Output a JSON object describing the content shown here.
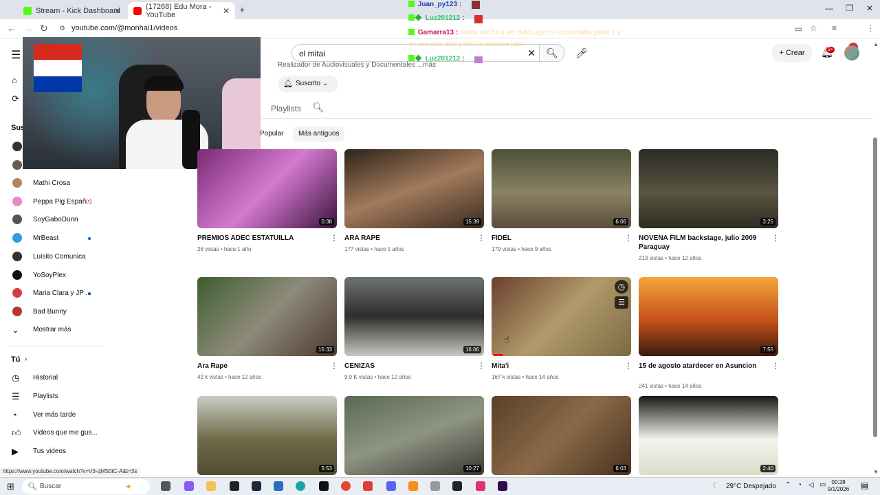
{
  "browser": {
    "tabs": [
      {
        "label": "Stream - Kick Dashboard",
        "favicon_color": "#53fc18",
        "active": false
      },
      {
        "label": "(17268) Edu Mora - YouTube",
        "favicon_color": "#ff0000",
        "active": true
      }
    ],
    "url": "youtube.com/@monhai1/videos"
  },
  "header": {
    "search_value": "el mitai",
    "create_label": "Crear",
    "notifications_badge": "9+"
  },
  "channel": {
    "description": "Realizador de Audiovisuales y Documentales ...más",
    "subscribe_label": "Suscrito",
    "tab_playlists": "Playlists",
    "chips": [
      "Popular",
      "Más antiguos"
    ]
  },
  "sidebar": {
    "subs_heading": "Sus",
    "subscriptions": [
      {
        "label": "Mathi Crosa",
        "color": "#b9835a",
        "dot": false
      },
      {
        "label": "Peppa Pig Españ...",
        "color": "#e98ac7",
        "live": true
      },
      {
        "label": "SoyGaboDunn",
        "color": "#555555",
        "dot": false
      },
      {
        "label": "MrBeast",
        "color": "#2d9fd8",
        "dot": true
      },
      {
        "label": "Luisito Comunica",
        "color": "#333333",
        "dot": false
      },
      {
        "label": "YoSoyPlex",
        "color": "#111111",
        "dot": false
      },
      {
        "label": "Maria Clara y JP ...",
        "color": "#d23d4a",
        "dot": true
      },
      {
        "label": "Bad Bunny",
        "color": "#b23a2b",
        "dot": false
      }
    ],
    "show_more": "Mostrar más",
    "you_heading": "Tú",
    "you_items": [
      "Historial",
      "Playlists",
      "Ver más tarde",
      "Videos que me gus...",
      "Tus videos"
    ]
  },
  "chat": [
    {
      "user": "Juan_py123",
      "user_color": "#1a3fb5",
      "message": "",
      "badge": "k"
    },
    {
      "user": "Luz201212",
      "user_color": "#39c46f",
      "message": "",
      "badge": "kg"
    },
    {
      "user": "Gamarra13",
      "user_color": "#c2185b",
      "message": "Samo me fui a ver mita'i ayer si encontraba parte 2 y",
      "badge": "k"
    },
    {
      "user": "",
      "user_color": "#c2185b",
      "message": "en ese que dice película aparece jaka",
      "badge": ""
    },
    {
      "user": "Luz201212",
      "user_color": "#39c46f",
      "message": "",
      "badge": "kg"
    }
  ],
  "videos": [
    {
      "title": "PREMIOS ADEC ESTATUILLA",
      "meta": "26 vistas • hace 1 año",
      "duration": "0:38",
      "bg": "linear-gradient(135deg,#7a2a76,#d47ad0 50%,#3d1340)"
    },
    {
      "title": "ARA RAPE",
      "meta": "177 vistas • hace 5 años",
      "duration": "15:39",
      "bg": "linear-gradient(160deg,#2d2419,#a37a5c 50%,#3a2c20)"
    },
    {
      "title": "FIDEL",
      "meta": "179 vistas • hace 9 años",
      "duration": "6:06",
      "bg": "linear-gradient(180deg,#4d5136,#8a8264 55%,#5b4d3a)"
    },
    {
      "title": "NOVENA FILM backstage, julio 2009 Paraguay",
      "meta": "213 vistas • hace 12 años",
      "duration": "3:25",
      "bg": "linear-gradient(180deg,#2b2b26,#5a5540 55%,#2e2a22)"
    },
    {
      "title": "Ara Rape",
      "meta": "42 k vistas • hace 12 años",
      "duration": "15:33",
      "bg": "linear-gradient(135deg,#3d5e30,#8d8b7a 50%,#4e3a30)"
    },
    {
      "title": "CENIZAS",
      "meta": "9.9 K vistas • hace 12 años",
      "duration": "16:06",
      "bg": "linear-gradient(180deg,#6d7270,#2e2e2c 50%,#c8c8c4)"
    },
    {
      "title": "Mita'i",
      "meta": "167 k vistas • hace 14 años",
      "duration": "",
      "bg": "linear-gradient(135deg,#6a4030,#b19a6a 50%,#7c6a44)",
      "progress": 0.08
    },
    {
      "title": "15 de agosto atardecer en Asuncion",
      "meta": "241 vistas • hace 14 años",
      "duration": "7:55",
      "bg": "linear-gradient(180deg,#f5a53a,#c4501a 55%,#3a1a0e)"
    },
    {
      "title": "",
      "meta": "",
      "duration": "5:53",
      "bg": "linear-gradient(180deg,#c9cdc3,#6e6b48 55%,#514c32)"
    },
    {
      "title": "",
      "meta": "",
      "duration": "10:27",
      "bg": "linear-gradient(160deg,#5a6a52,#8e9484 50%,#3c3a30)"
    },
    {
      "title": "",
      "meta": "",
      "duration": "6:03",
      "bg": "linear-gradient(135deg,#5a4028,#8a6a48 50%,#4a3220)"
    },
    {
      "title": "",
      "meta": "",
      "duration": "2:40",
      "bg": "linear-gradient(180deg,#1a1a14,#f4f4ee 55%,#dcdcc8)"
    }
  ],
  "status_url": "https://www.youtube.com/watch?v=V3-qMS0tC-A&t=3s",
  "taskbar": {
    "search_label": "Buscar",
    "weather": "29°C  Despejado",
    "time": "00:28",
    "date": "9/1/2026"
  }
}
